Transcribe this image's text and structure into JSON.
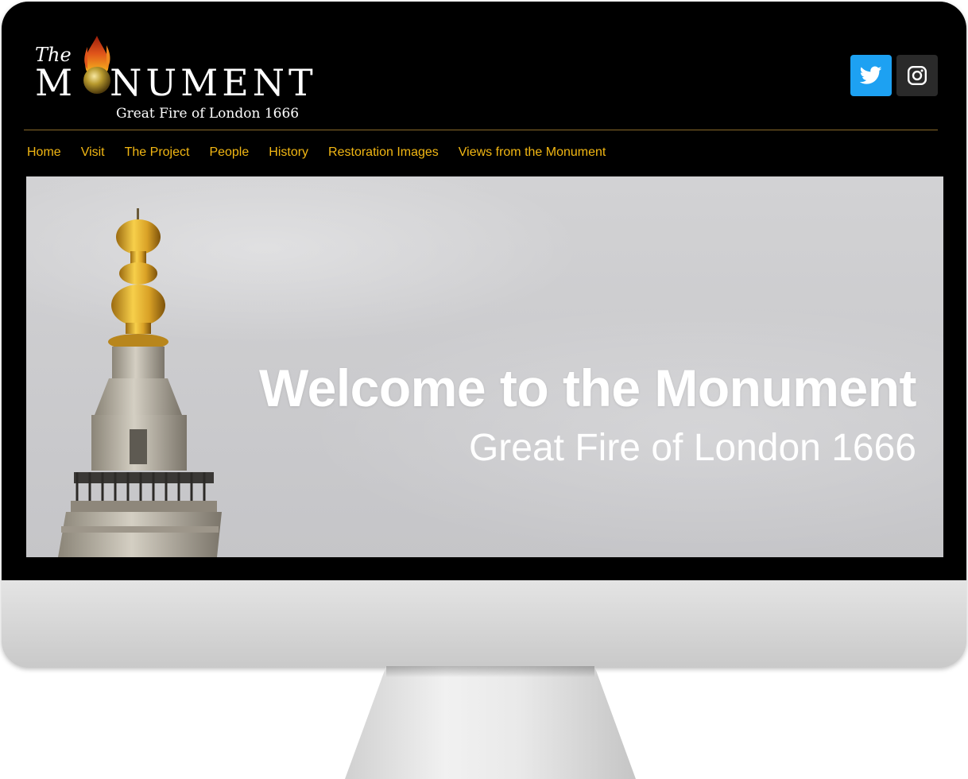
{
  "logo": {
    "the": "The",
    "m": "M",
    "rest": "NUMENT",
    "subtitle": "Great Fire of London 1666"
  },
  "social": [
    {
      "name": "twitter",
      "icon": "twitter-icon",
      "color": "#1da1f2"
    },
    {
      "name": "instagram",
      "icon": "instagram-icon",
      "color": "#2a2a2a"
    }
  ],
  "nav": {
    "items": [
      "Home",
      "Visit",
      "The Project",
      "People",
      "History",
      "Restoration Images",
      "Views from the Monument"
    ],
    "color": "#f2b713"
  },
  "hero": {
    "title": "Welcome to the Monument",
    "subtitle": "Great Fire of London 1666"
  }
}
